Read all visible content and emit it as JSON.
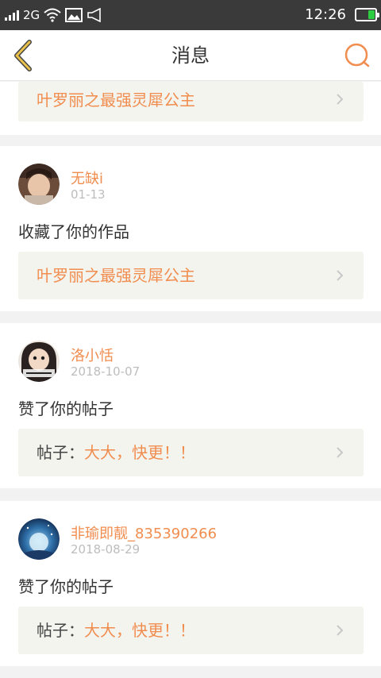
{
  "status_bar": {
    "network": "2G",
    "time": "12:26",
    "icons": [
      "signal-icon",
      "wifi-icon",
      "image-icon",
      "speaker-icon",
      "battery-icon"
    ]
  },
  "header": {
    "title": "消息",
    "back_icon": "chevron-left-icon",
    "search_icon": "search-icon"
  },
  "colors": {
    "accent": "#f08d4f",
    "back_icon": "#e8c04a",
    "statusbar": "#3a3a3a",
    "ref_background": "#f4f4ef"
  },
  "partial_card": {
    "ref_title": "叶罗丽之最强灵犀公主"
  },
  "messages": [
    {
      "username": "无缺i",
      "date": "01-13",
      "action": "收藏了你的作品",
      "ref_prefix": "",
      "ref_title": "叶罗丽之最强灵犀公主"
    },
    {
      "username": "洛小恬",
      "date": "2018-10-07",
      "action": "赞了你的帖子",
      "ref_prefix": "帖子：",
      "ref_title": "大大，快更！！"
    },
    {
      "username": "非瑜即靓_835390266",
      "date": "2018-08-29",
      "action": "赞了你的帖子",
      "ref_prefix": "帖子：",
      "ref_title": "大大，快更！！"
    }
  ]
}
